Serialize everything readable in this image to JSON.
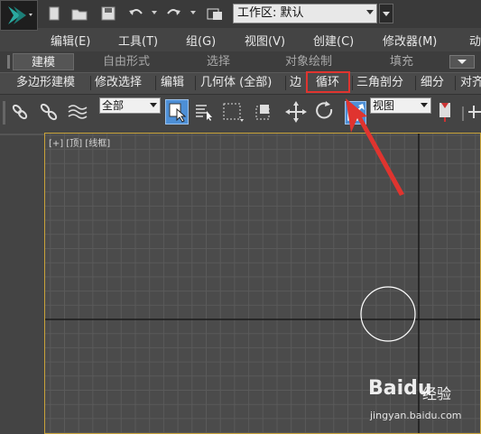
{
  "titlebar": {
    "workspace_label": "工作区: 默认"
  },
  "menubar": {
    "items": [
      {
        "label": "编辑(E)"
      },
      {
        "label": "工具(T)"
      },
      {
        "label": "组(G)"
      },
      {
        "label": "视图(V)"
      },
      {
        "label": "创建(C)"
      },
      {
        "label": "修改器(M)"
      },
      {
        "label": "动"
      }
    ]
  },
  "ribbon": {
    "tabs": [
      {
        "label": "建模"
      },
      {
        "label": "自由形式"
      },
      {
        "label": "选择"
      },
      {
        "label": "对象绘制"
      },
      {
        "label": "填充"
      }
    ],
    "panel_buttons": [
      {
        "label": "多边形建模"
      },
      {
        "label": "修改选择"
      },
      {
        "label": "编辑"
      },
      {
        "label": "几何体 (全部)"
      },
      {
        "label": "边"
      },
      {
        "label": "循环"
      },
      {
        "label": "三角剖分"
      },
      {
        "label": "细分"
      },
      {
        "label": "对齐"
      }
    ]
  },
  "toolbar": {
    "selection_filter": "全部",
    "reference_coord": "视图"
  },
  "viewport": {
    "label": "[+] [顶] [线框]"
  },
  "watermark": {
    "brand": "Baidu",
    "cn": "经验",
    "url": "jingyan.baidu.com"
  },
  "colors": {
    "highlight": "#e0342f",
    "viewport_border": "#c9a33a",
    "grid_line": "#5a5a5a",
    "axis_line": "#1a1a1a"
  }
}
